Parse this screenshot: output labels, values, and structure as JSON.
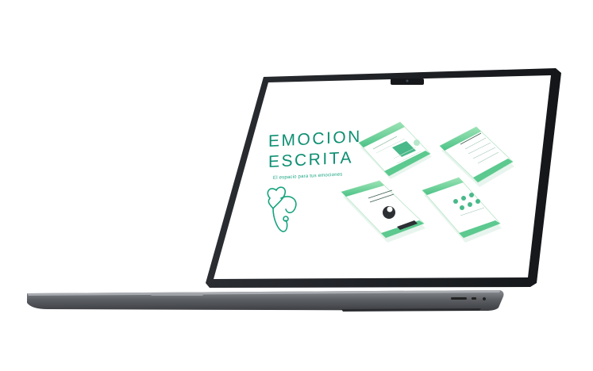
{
  "presentation": {
    "title_line1": "EMOCION",
    "title_line2": "ESCRITA",
    "subtitle": "El espacio para tus emociones"
  },
  "mockups": [
    {
      "name": "phone-screen-top-left"
    },
    {
      "name": "phone-screen-top-right"
    },
    {
      "name": "phone-screen-bottom-left"
    },
    {
      "name": "phone-screen-bottom-right"
    }
  ],
  "icons": {
    "logo": "heart-stethoscope-icon",
    "camera": "webcam-icon"
  },
  "colors": {
    "accent": "#0e8f73",
    "accent_light": "#7edba6",
    "device_dark": "#1f2227",
    "device_base": "#5a5d62"
  }
}
